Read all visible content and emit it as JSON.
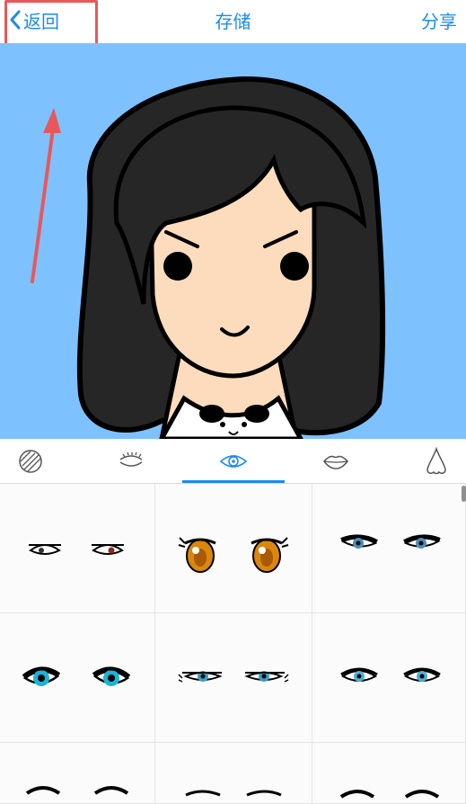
{
  "nav": {
    "back_label": "返回",
    "title": "存储",
    "share_label": "分享"
  },
  "tabs": [
    {
      "icon": "hair-texture-icon",
      "active": false
    },
    {
      "icon": "closed-eye-icon",
      "active": false
    },
    {
      "icon": "eye-icon",
      "active": true
    },
    {
      "icon": "lips-icon",
      "active": false
    },
    {
      "icon": "nose-icon",
      "active": false
    }
  ],
  "eye_options": [
    "eye-style-1",
    "eye-style-2",
    "eye-style-3",
    "eye-style-4",
    "eye-style-5",
    "eye-style-6",
    "eye-style-7",
    "eye-style-8",
    "eye-style-9"
  ],
  "colors": {
    "accent": "#1a8cf0",
    "canvas_bg": "#7ec1ff",
    "annotation": "#e8585a",
    "hair": "#262626",
    "skin": "#fcdcbc"
  }
}
